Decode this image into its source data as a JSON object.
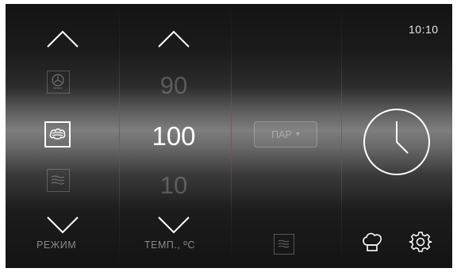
{
  "status": {
    "time": "10:10"
  },
  "mode_column": {
    "label": "РЕЖИМ",
    "modes": [
      {
        "icon": "fan-mode-icon",
        "state": "dim"
      },
      {
        "icon": "steam-mode-icon",
        "state": "selected"
      },
      {
        "icon": "grill-mode-icon",
        "state": "dim"
      }
    ]
  },
  "temperature_column": {
    "label": "ТЕМП., ºC",
    "prev_value": "90",
    "current_value": "100",
    "next_value": "10"
  },
  "steam_column": {
    "button_label": "ПАР",
    "button_arrow": "▾"
  },
  "timer_column": {
    "icon": "clock-icon"
  },
  "bottom_bar": {
    "icons": [
      "steam-level-icon",
      "chef-hat-icon",
      "gear-icon"
    ]
  },
  "colors": {
    "divider": "#c83232",
    "text_active": "#ffffff",
    "text_dim": "#5a5a5a"
  }
}
